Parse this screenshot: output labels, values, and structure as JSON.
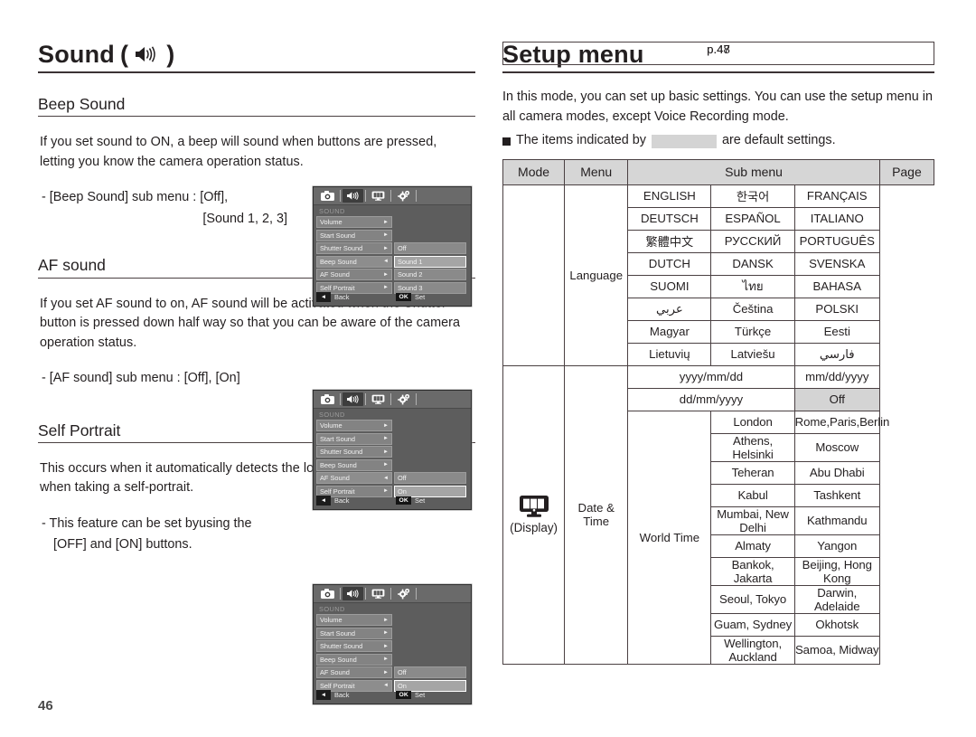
{
  "page_number": "46",
  "left": {
    "title": "Sound",
    "title_paren_open": "(",
    "title_paren_close": ")",
    "title_icon": "speaker-icon",
    "sections": [
      {
        "heading": "Beep Sound",
        "paragraph": "If you set sound to ON, a beep will sound when buttons are pressed, letting you know the camera operation status.",
        "sub_line1": "- [Beep Sound] sub menu : [Off],",
        "sub_line2": "[Sound 1, 2, 3]"
      },
      {
        "heading": "AF sound",
        "paragraph": "If you set AF sound to on, AF sound will be activated when the Shutter button is pressed down half way so that you can be aware of the camera operation status.",
        "sub_line1": "- [AF sound] sub menu : [Off], [On]",
        "sub_line2": ""
      },
      {
        "heading": "Self Portrait",
        "paragraph": "This occurs when it automatically detects the location of the subject’s face when taking a self-portrait.",
        "sub_line1": "- This feature can be set byusing the",
        "sub_line2": "[OFF] and [ON] buttons."
      }
    ]
  },
  "lcd": {
    "tabs": [
      "camera-icon",
      "speaker-icon",
      "display-icon",
      "settings-icon"
    ],
    "screen_title": "SOUND",
    "menu_items": [
      "Volume",
      "Start Sound",
      "Shutter Sound",
      "Beep Sound",
      "AF Sound",
      "Self Portrait"
    ],
    "back_label": "Back",
    "ok_label": "OK",
    "set_label": "Set",
    "screens": [
      {
        "active_index": 3,
        "sub_start_index": 2,
        "sub_items": [
          "Off",
          "Sound 1",
          "Sound 2",
          "Sound 3"
        ],
        "highlight_index": 1
      },
      {
        "active_index": 4,
        "sub_start_index": 4,
        "sub_items": [
          "Off",
          "On"
        ],
        "highlight_index": 1
      },
      {
        "active_index": 5,
        "sub_start_index": 4,
        "sub_items": [
          "Off",
          "On"
        ],
        "highlight_index": 1
      }
    ]
  },
  "right": {
    "title": "Setup menu",
    "intro": "In this mode, you can set up basic settings. You can use the setup menu in all camera modes, except Voice Recording mode.",
    "bullet_prefix": "The items indicated by",
    "bullet_suffix": "are default settings.",
    "table": {
      "headers": [
        "Mode",
        "Menu",
        "Sub menu",
        "Page"
      ],
      "language": {
        "menu": "Language",
        "page": "p.47",
        "rows": [
          [
            "ENGLISH",
            "한국어",
            "FRANÇAIS"
          ],
          [
            "DEUTSCH",
            "ESPAÑOL",
            "ITALIANO"
          ],
          [
            "繁體中文",
            "РУССКИЙ",
            "PORTUGUÊS"
          ],
          [
            "DUTCH",
            "DANSK",
            "SVENSKA"
          ],
          [
            "SUOMI",
            "ไทย",
            "BAHASA"
          ],
          [
            "عربي",
            "Čeština",
            "POLSKI"
          ],
          [
            "Magyar",
            "Türkçe",
            "Eesti"
          ],
          [
            "Lietuvių",
            "Latviešu",
            "فارسي"
          ]
        ]
      },
      "display": {
        "mode_icon": "display-icon",
        "mode_caption": "(Display)",
        "menu": "Date & Time",
        "page": "p.48",
        "date_formats": [
          {
            "label": "yyyy/mm/dd",
            "default": false
          },
          {
            "label": "mm/dd/yyyy",
            "default": false
          },
          {
            "label": "dd/mm/yyyy",
            "default": false
          },
          {
            "label": "Off",
            "default": true
          }
        ],
        "world_time_label": "World Time",
        "world_time": [
          [
            "London",
            "Rome,Paris,Berlin"
          ],
          [
            "Athens, Helsinki",
            "Moscow"
          ],
          [
            "Teheran",
            "Abu Dhabi"
          ],
          [
            "Kabul",
            "Tashkent"
          ],
          [
            "Mumbai, New Delhi",
            "Kathmandu"
          ],
          [
            "Almaty",
            "Yangon"
          ],
          [
            "Bankok, Jakarta",
            "Beijing, Hong Kong"
          ],
          [
            "Seoul, Tokyo",
            "Darwin, Adelaide"
          ],
          [
            "Guam, Sydney",
            "Okhotsk"
          ],
          [
            "Wellington, Auckland",
            "Samoa, Midway"
          ]
        ]
      }
    }
  }
}
